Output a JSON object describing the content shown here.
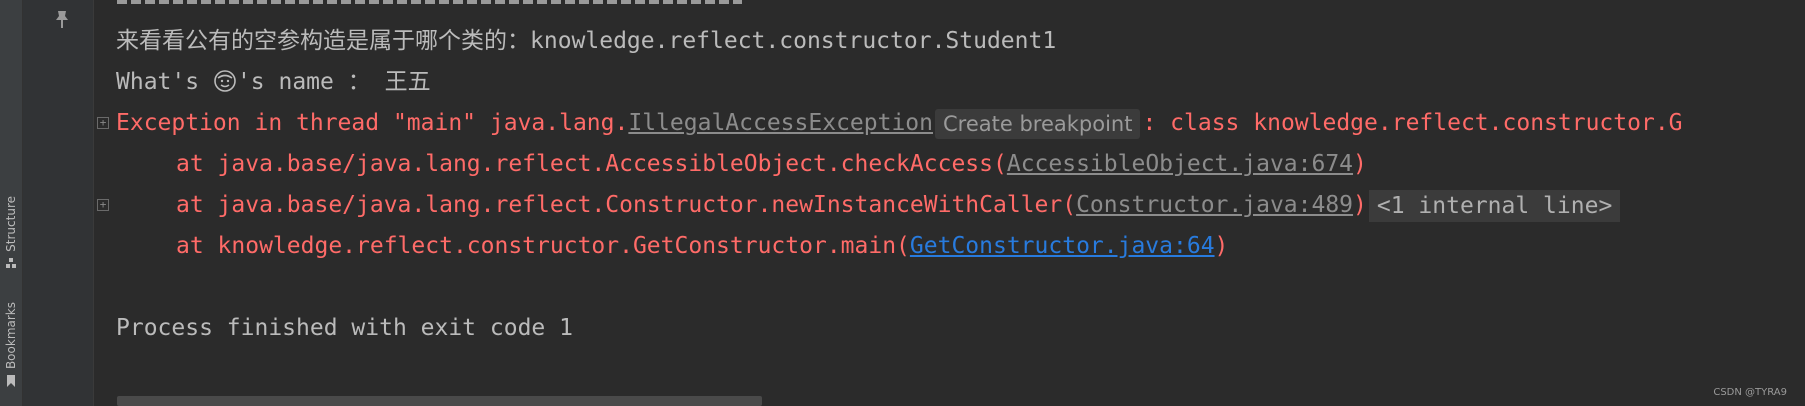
{
  "sidebar": {
    "structure_label": "Structure",
    "bookmarks_label": "Bookmarks",
    "structure_icon": "structure-icon",
    "bookmark_icon": "bookmark-icon"
  },
  "toolbar": {
    "pin_icon": "pin-icon"
  },
  "console": {
    "line1": {
      "text_cn": "来看看公有的空参构造是属于哪个类的：",
      "text": "knowledge.reflect.constructor.Student1"
    },
    "line2": {
      "prefix": "What's ",
      "emoji": "smiling-face-icon",
      "suffix": "'s name ：",
      "name": "王五"
    },
    "exception": {
      "prefix": "Exception in thread \"main\" java.lang.",
      "type": "IllegalAccessException",
      "hint": "Create breakpoint",
      "message": ": class knowledge.reflect.constructor.G"
    },
    "frames": [
      {
        "prefix": "at java.base/java.lang.reflect.AccessibleObject.checkAccess(",
        "link": "AccessibleObject.java:674",
        "suffix": ")"
      },
      {
        "prefix": "at java.base/java.lang.reflect.Constructor.newInstanceWithCaller(",
        "link": "Constructor.java:489",
        "suffix": ")",
        "fold": "<1 internal line>"
      },
      {
        "prefix": "at knowledge.reflect.constructor.GetConstructor.main(",
        "link": "GetConstructor.java:64",
        "suffix": ")"
      }
    ],
    "process_finished": "Process finished with exit code 1"
  },
  "watermark": "CSDN @TYRA9",
  "colors": {
    "background": "#2b2b2b",
    "error": "#ff6b68",
    "link": "#287bde",
    "text": "#bbbbbb"
  }
}
